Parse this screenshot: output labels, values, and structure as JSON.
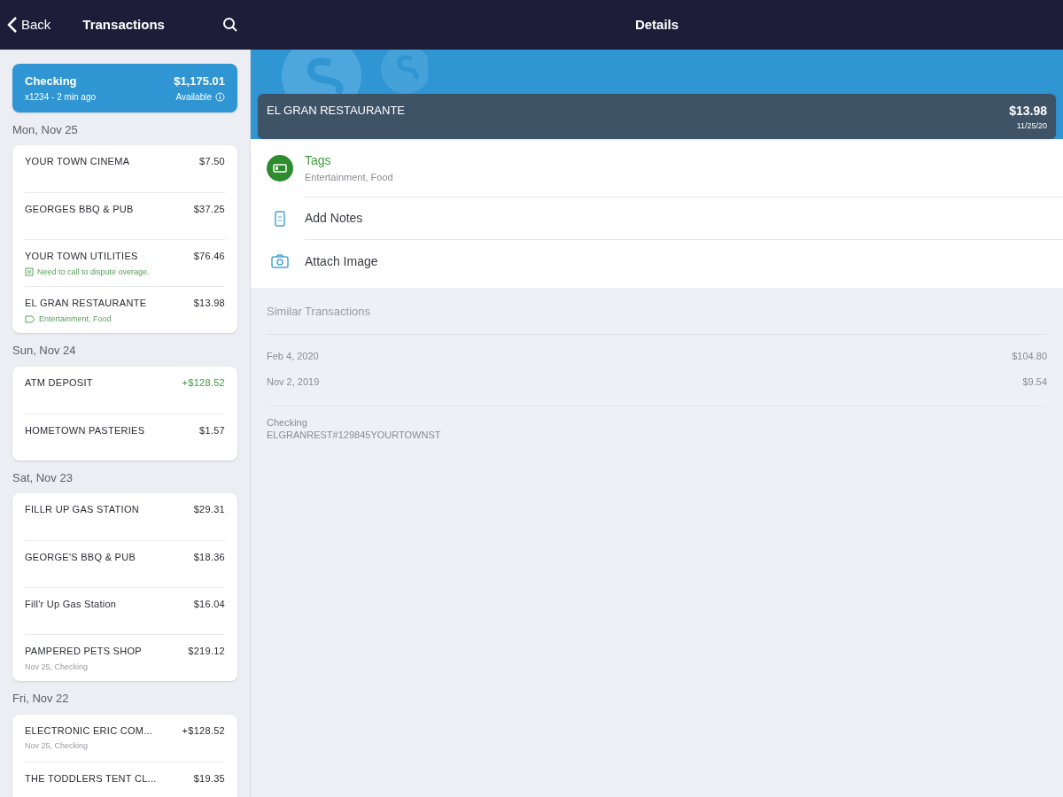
{
  "nav": {
    "back": "Back",
    "title": "Transactions",
    "detail_title": "Details"
  },
  "account": {
    "name": "Checking",
    "sub": "x1234 - 2 min ago",
    "balance": "$1,175.01",
    "balance_label": "Available"
  },
  "groups": [
    {
      "date": "Mon, Nov 25",
      "transactions": [
        {
          "name": "YOUR TOWN CINEMA",
          "amount": "$7.50",
          "credit": false
        },
        {
          "name": "GEORGES BBQ & PUB",
          "amount": "$37.25",
          "credit": false
        },
        {
          "name": "YOUR TOWN UTILITIES",
          "amount": "$76.46",
          "credit": false,
          "detail": {
            "kind": "note",
            "text": "Need to call to dispute overage."
          }
        },
        {
          "name": "EL GRAN RESTAURANTE",
          "amount": "$13.98",
          "credit": false,
          "detail": {
            "kind": "tags",
            "text": "Entertainment, Food"
          }
        }
      ]
    },
    {
      "date": "Sun, Nov 24",
      "transactions": [
        {
          "name": "ATM DEPOSIT",
          "amount": "+$128.52",
          "credit": true
        },
        {
          "name": "HOMETOWN PASTERIES",
          "amount": "$1.57",
          "credit": false
        }
      ]
    },
    {
      "date": "Sat, Nov 23",
      "transactions": [
        {
          "name": "FILLR UP GAS STATION",
          "amount": "$29.31",
          "credit": false
        },
        {
          "name": "GEORGE'S BBQ & PUB",
          "amount": "$18.36",
          "credit": false
        },
        {
          "name": "Fill'r Up Gas Station",
          "amount": "$16.04",
          "credit": false
        },
        {
          "name": "PAMPERED PETS SHOP",
          "amount": "$219.12",
          "credit": false,
          "detail": {
            "kind": "meta",
            "text": "Nov 25, Checking"
          }
        }
      ]
    },
    {
      "date": "Fri, Nov 22",
      "transactions": [
        {
          "name": "ELECTRONIC ERIC COM...",
          "amount": "+$128.52",
          "credit": false,
          "detail": {
            "kind": "meta",
            "text": "Nov 25, Checking"
          }
        },
        {
          "name": "THE TODDLERS TENT CL...",
          "amount": "$19.35",
          "credit": false
        }
      ]
    }
  ],
  "detail": {
    "name": "EL GRAN RESTAURANTE",
    "amount": "$13.98",
    "date": "11/25/20",
    "actions": [
      {
        "kind": "tags",
        "label": "Tags",
        "sub": "Entertainment, Food"
      },
      {
        "kind": "notes",
        "label": "Add Notes"
      },
      {
        "kind": "image",
        "label": "Attach Image"
      }
    ],
    "similar_title": "Similar Transactions",
    "similar": [
      {
        "date": "Feb 4, 2020",
        "amount": "$104.80"
      },
      {
        "date": "Nov 2, 2019",
        "amount": "$9.54"
      }
    ],
    "account": "Checking",
    "memo": "ELGRANREST#129845YOURTOWNST"
  }
}
